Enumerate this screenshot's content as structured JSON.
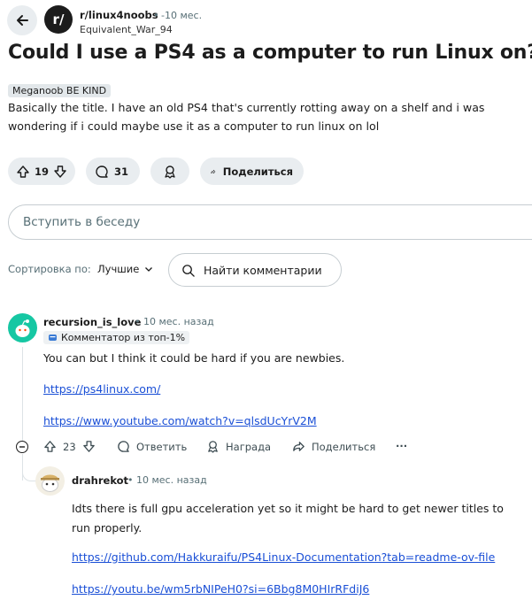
{
  "header": {
    "subreddit": "r/linux4noobs",
    "separator": "•",
    "time": "-10 мес.",
    "author": "Equivalent_War_94",
    "logo_text": "r/"
  },
  "post": {
    "title": "Could I use a PS4 as a computer to run Linux on?",
    "flair": "Meganoob BE KIND",
    "body": "Basically the title. I have an old PS4 that's currently rotting away on a shelf and i was wondering if i could maybe use it as a computer to run linux on lol",
    "votes": "19",
    "comments": "31",
    "share_label": "Поделиться"
  },
  "join": {
    "placeholder": "Вступить в беседу"
  },
  "sort": {
    "label": "Сортировка по:",
    "value": "Лучшие",
    "search_placeholder": "Найти комментарии"
  },
  "comments": [
    {
      "user": "recursion_is_love",
      "meta": "• 10 мес. назад",
      "badge": "Комментатор из топ-1%",
      "text": "You can but I think it could be hard if you are newbies.",
      "link1": "https://ps4linux.com/",
      "link2": "https://www.youtube.com/watch?v=qlsdUcYrV2M",
      "votes": "23",
      "reply_label": "Ответить",
      "award_label": "Награда",
      "share_label": "Поделиться",
      "more": "···"
    },
    {
      "user": "drahrekot",
      "meta": "• 10 мес. назад",
      "text": "Idts there is full gpu acceleration yet so it might be hard to get newer titles to run properly.",
      "link1": "https://github.com/Hakkuraifu/PS4Linux-Documentation?tab=readme-ov-file",
      "link2": "https://youtu.be/wm5rbNIPeH0?si=6Bbg8M0HIrRFdiJ6"
    }
  ],
  "colors": {
    "pill_bg": "#e9edf0",
    "link": "#1a4fd6",
    "avatar_green": "#16c7a3"
  }
}
